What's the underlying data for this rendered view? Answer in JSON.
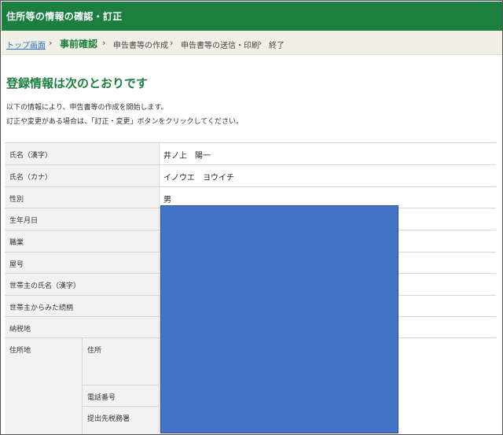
{
  "header": {
    "title": "住所等の情報の確認・訂正"
  },
  "breadcrumb": {
    "top_link": "トップ画面",
    "current": "事前確認",
    "steps": [
      "申告書等の作成",
      "申告書等の送信・印刷",
      "終了"
    ],
    "separator": "›"
  },
  "main": {
    "heading": "登録情報は次のとおりです",
    "description": [
      "以下の情報により、申告書等の作成を開始します。",
      "訂正や変更がある場合は、「訂正・変更」ボタンをクリックしてください。"
    ]
  },
  "table": {
    "rows": [
      {
        "label": "氏名（漢字）",
        "value": "井ノ上　陽一"
      },
      {
        "label": "氏名（カナ）",
        "value": "イノウエ　ヨウイチ"
      },
      {
        "label": "性別",
        "value": "男"
      },
      {
        "label": "生年月日",
        "value": ""
      },
      {
        "label": "職業",
        "value": ""
      },
      {
        "label": "屋号",
        "value": ""
      },
      {
        "label": "世帯主の氏名（漢字）",
        "value": ""
      },
      {
        "label": "世帯主からみた続柄",
        "value": ""
      },
      {
        "label": "納税地",
        "value": ""
      }
    ],
    "address": {
      "label": "住所地",
      "sub_rows": [
        {
          "label": "住所",
          "value": ""
        },
        {
          "label": "電話番号",
          "value": ""
        },
        {
          "label": "提出先税務署",
          "value": ""
        }
      ]
    }
  },
  "redaction": {
    "color": "#4472c4"
  },
  "colors": {
    "brand_green": "#1a7f3f",
    "breadcrumb_bg": "#f2f0e6",
    "label_bg": "#f2f2f2"
  }
}
